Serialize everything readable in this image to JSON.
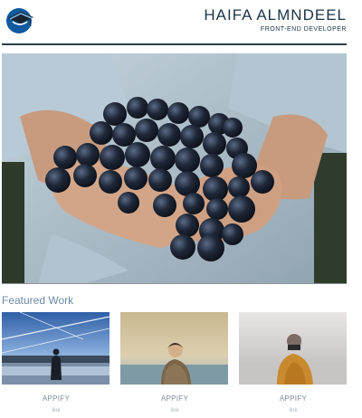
{
  "header": {
    "name": "HAIFA ALMNDEEL",
    "role": "FRONT-END DEVELOPER"
  },
  "featured": {
    "heading": "Featured Work",
    "projects": [
      {
        "title": "APPIFY",
        "link": "link"
      },
      {
        "title": "APPIFY",
        "link": "link"
      },
      {
        "title": "APPIFY",
        "link": "link"
      }
    ]
  },
  "colors": {
    "accent": "#6c8aa5",
    "heading": "#1b3347",
    "rule": "#2a3f4f"
  },
  "icons": {
    "logo": "udacity-logo-icon"
  }
}
